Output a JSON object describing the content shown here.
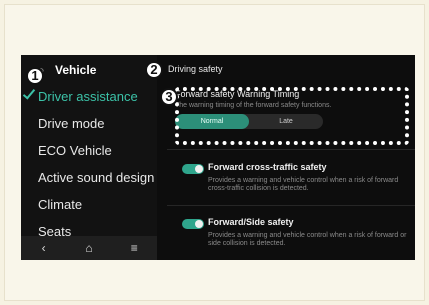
{
  "sidebar": {
    "back_icon": "search-icon",
    "title": "Vehicle",
    "items": [
      {
        "label": "Driver assistance",
        "active": true
      },
      {
        "label": "Drive mode",
        "active": false
      },
      {
        "label": "ECO Vehicle",
        "active": false
      },
      {
        "label": "Active sound design",
        "active": false
      },
      {
        "label": "Climate",
        "active": false
      },
      {
        "label": "Seats",
        "active": false
      }
    ],
    "nav": {
      "back": "‹",
      "home": "⌂",
      "menu": "≡"
    }
  },
  "panel": {
    "title": "Driving safety",
    "timing": {
      "title": "Forward safety Warning Timing",
      "description": "The warning timing of the forward safety functions.",
      "options": [
        "Normal",
        "Late"
      ],
      "selected": "Normal"
    },
    "toggles": [
      {
        "title": "Forward cross-traffic safety",
        "description": "Provides a warning and vehicle control when a risk of forward cross-traffic collision is detected.",
        "on": true
      },
      {
        "title": "Forward/Side safety",
        "description": "Provides a warning and vehicle control when a risk of forward or side collision is detected.",
        "on": true
      }
    ]
  },
  "callouts": [
    "1",
    "2",
    "3"
  ],
  "colors": {
    "accent": "#3cc2a8",
    "toggle": "#2fa58c",
    "background": "#0d0d0d"
  }
}
